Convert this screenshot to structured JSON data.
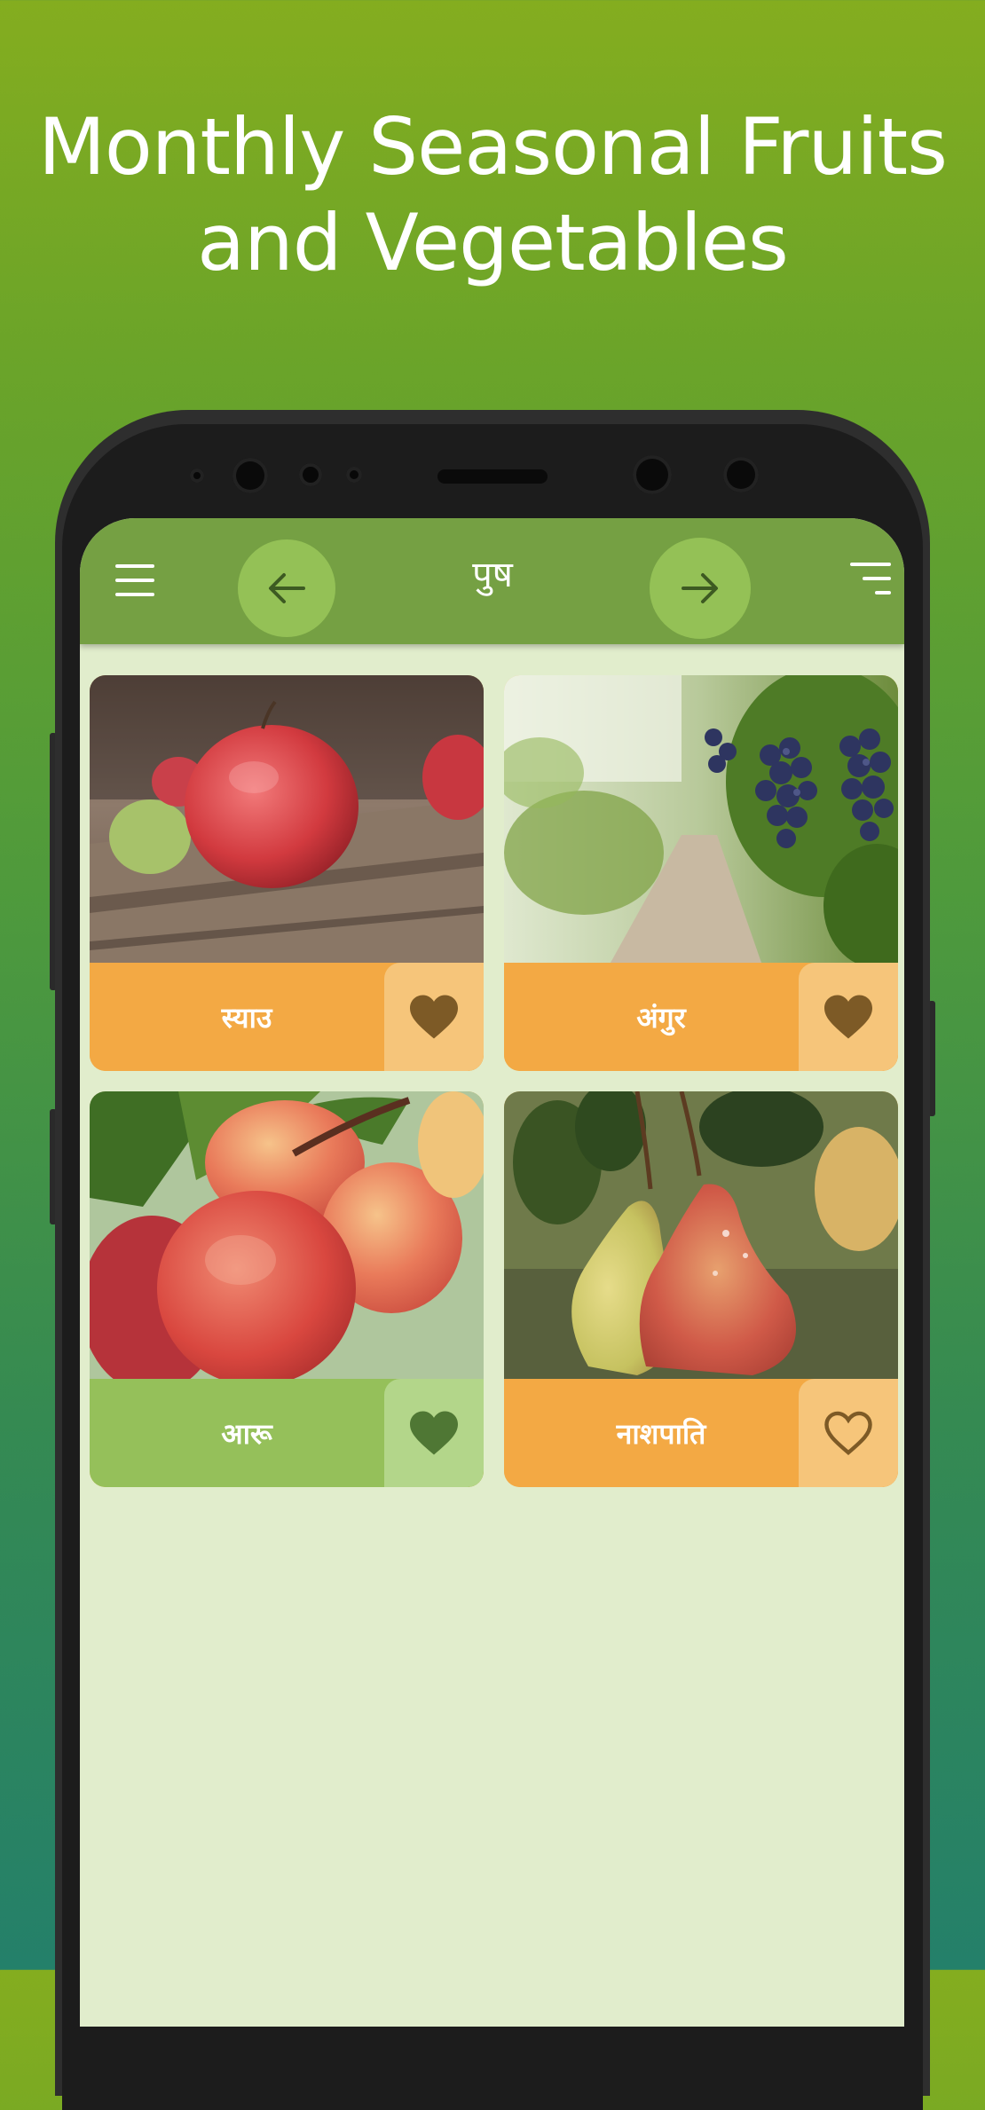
{
  "headline": {
    "line1": "Monthly Seasonal Fruits",
    "line2": "and Vegetables"
  },
  "appbar": {
    "title": "पुष"
  },
  "colors": {
    "appbar": "#75a043",
    "nav_button": "#94c156",
    "screen_background": "#e1edcc",
    "card_orange": "#f3a944",
    "card_green": "#95c05a",
    "heart_brown": "#7d5a26",
    "heart_green": "#4f7734"
  },
  "icons": {
    "menu": "menu-icon",
    "previous": "arrow-left-icon",
    "next": "arrow-right-icon",
    "sort": "sort-icon",
    "favorite_filled": "heart-filled-icon",
    "favorite_outline": "heart-outline-icon"
  },
  "items": [
    {
      "name": "स्याउ",
      "photo": "apple-photo",
      "favorite": true,
      "color": "orange"
    },
    {
      "name": "अंगुर",
      "photo": "grapes-photo",
      "favorite": true,
      "color": "orange"
    },
    {
      "name": "आरू",
      "photo": "peach-photo",
      "favorite": true,
      "color": "green"
    },
    {
      "name": "नाशपाति",
      "photo": "pear-photo",
      "favorite": false,
      "color": "orange"
    }
  ]
}
